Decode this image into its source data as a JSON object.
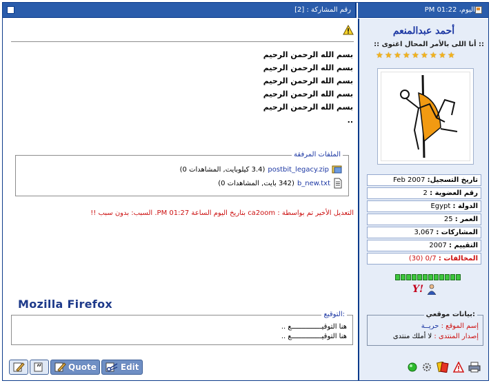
{
  "header": {
    "post_number": "رقم المشاركة : [2]",
    "date": "اليوم، 01:22 PM"
  },
  "user": {
    "name": "أحمد عبدالمنعم",
    "title": ":: أنا اللى بالأمر المحال اغتوى ::",
    "stars_count": 9,
    "info": [
      {
        "label": "تاريخ التسجيل:",
        "value": "Feb 2007"
      },
      {
        "label": "رقم العضوية :",
        "value": "2"
      },
      {
        "label": "الدولة :",
        "value": "Egypt"
      },
      {
        "label": "العمر :",
        "value": "25"
      },
      {
        "label": "المشاركات :",
        "value": "3,067"
      },
      {
        "label": "التقييم :",
        "value": "2007"
      },
      {
        "label": "المخالفات :",
        "value": "0/7 (30)"
      }
    ],
    "reputation_pips": 12,
    "site": {
      "legend": "بيانات موقعي:",
      "name_label": "إسم الموقع :",
      "name_value": "حريــة",
      "version_label": "إصدار المنتدى :",
      "version_value": "لا أملك منتدى"
    }
  },
  "post": {
    "lines": [
      "بسم الله الرحمن الرحيم",
      "بسم الله الرحمن الرحيم",
      "بسم الله الرحمن الرحيم",
      "بسم الله الرحمن الرحيم",
      "بسم الله الرحمن الرحيم",
      ".."
    ],
    "attachments": {
      "legend": "الملفات المرفقة",
      "files": [
        {
          "name": "postbit_legacy.zip",
          "meta": "(3.4 كيلوبايت, المشاهدات 0)",
          "icon": "zip-icon"
        },
        {
          "name": "b_new.txt",
          "meta": "(342 بايت, المشاهدات 0)",
          "icon": "text-file-icon"
        }
      ]
    },
    "edit_note": "التعديل الأخير تم بواسطة : ca2oom بتاريخ اليوم الساعة 01:27 PM. السبب: بدون سبب !!",
    "browser_label": "Mozilla Firefox",
    "signature": {
      "legend": "التوقيع:",
      "lines": [
        "هنا التوقيـــــــــــــــع ..",
        "هنا التوقيـــــــــــــــع .."
      ]
    }
  },
  "buttons": {
    "quote": "Quote",
    "edit": "Edit"
  }
}
